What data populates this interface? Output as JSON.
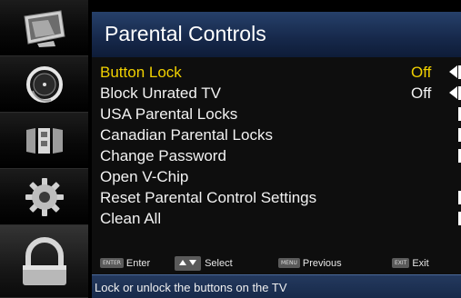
{
  "sidebar": {
    "items": [
      {
        "icon": "picture-icon",
        "selected": false
      },
      {
        "icon": "audio-icon",
        "selected": false
      },
      {
        "icon": "channels-icon",
        "selected": false
      },
      {
        "icon": "settings-gear-icon",
        "selected": false
      },
      {
        "icon": "parental-lock-icon",
        "selected": true
      }
    ]
  },
  "header": {
    "title": "Parental Controls"
  },
  "menu": {
    "items": [
      {
        "label": "Button Lock",
        "value": "Off",
        "active": true
      },
      {
        "label": "Block Unrated TV",
        "value": "Off",
        "active": false
      },
      {
        "label": "USA Parental Locks",
        "value": "",
        "active": false
      },
      {
        "label": "Canadian Parental Locks",
        "value": "",
        "active": false
      },
      {
        "label": "Change Password",
        "value": "",
        "active": false
      },
      {
        "label": "Open V-Chip",
        "value": "",
        "active": false
      },
      {
        "label": "Reset Parental Control Settings",
        "value": "",
        "active": false
      },
      {
        "label": "Clean All",
        "value": "",
        "active": false
      }
    ]
  },
  "hints": {
    "enter": {
      "key": "ENTER",
      "label": "Enter"
    },
    "select": {
      "label": "Select"
    },
    "previous": {
      "key": "MENU",
      "label": "Previous"
    },
    "exit": {
      "key": "EXIT",
      "label": "Exit"
    }
  },
  "status": {
    "text": "Lock or unlock the buttons on the TV"
  },
  "colors": {
    "accent": "#f0d000",
    "title_bar": "#1b3055",
    "status_bar": "#1d3254"
  }
}
